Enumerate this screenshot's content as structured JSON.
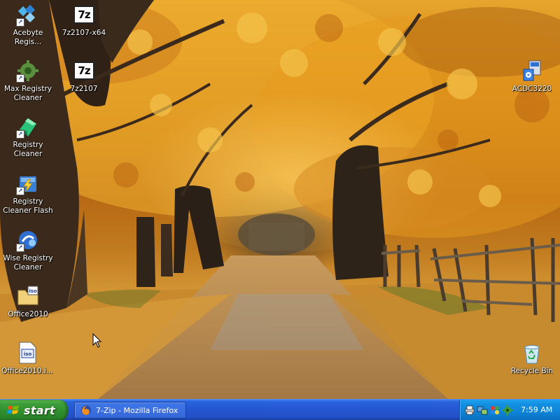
{
  "desktop": {
    "icons_left": [
      {
        "label": "Acebyte\nRegis...",
        "icon": "acebyte-registry-icon",
        "shortcut": true
      },
      {
        "label": "Max Registry\nCleaner",
        "icon": "max-registry-cleaner-icon",
        "shortcut": true
      },
      {
        "label": "Registry\nCleaner",
        "icon": "registry-cleaner-icon",
        "shortcut": true
      },
      {
        "label": "Registry\nCleaner Flash",
        "icon": "registry-cleaner-flash-icon",
        "shortcut": true
      },
      {
        "label": "Wise Registry\nCleaner",
        "icon": "wise-registry-cleaner-icon",
        "shortcut": true
      },
      {
        "label": "Office2010",
        "icon": "iso-folder-icon",
        "shortcut": false
      },
      {
        "label": "Office2010.i...",
        "icon": "iso-file-icon",
        "shortcut": false
      }
    ],
    "icons_second": [
      {
        "label": "7z2107-x64",
        "icon": "sevenzip-icon",
        "glyph_text": "7z"
      },
      {
        "label": "7z2107",
        "icon": "sevenzip-icon",
        "glyph_text": "7z"
      }
    ],
    "icons_right": [
      {
        "label": "ACDC3220",
        "icon": "acdc-installer-icon"
      },
      {
        "label": "Recycle Bin",
        "icon": "recycle-bin-icon"
      }
    ]
  },
  "taskbar": {
    "start_label": "start",
    "tasks": [
      {
        "label": "7-Zip - Mozilla Firefox",
        "icon": "firefox-icon"
      }
    ],
    "tray": {
      "icons": [
        "tray-printer-icon",
        "tray-network-icon",
        "tray-shield-icon",
        "tray-gear-icon"
      ],
      "clock": "7:59 AM"
    }
  },
  "colors": {
    "taskbar_blue": "#2456d1",
    "start_green": "#3c9e3a",
    "tray_blue": "#1390e2"
  }
}
